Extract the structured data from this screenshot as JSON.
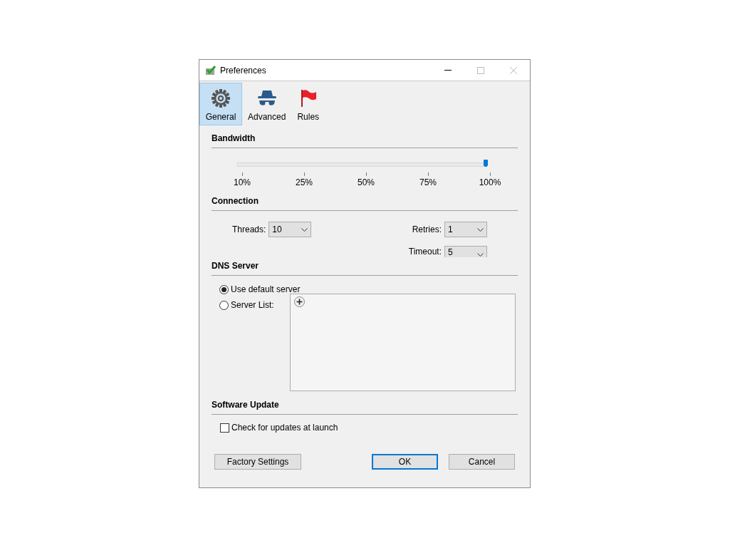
{
  "window": {
    "title": "Preferences"
  },
  "tabs": [
    {
      "label": "General",
      "selected": true,
      "kind": "gear"
    },
    {
      "label": "Advanced",
      "selected": false,
      "kind": "spy"
    },
    {
      "label": "Rules",
      "selected": false,
      "kind": "flag"
    }
  ],
  "bandwidth": {
    "heading": "Bandwidth",
    "level": 1,
    "ticks": [
      "10%",
      "25%",
      "50%",
      "75%",
      "100%"
    ]
  },
  "connection": {
    "heading": "Connection",
    "fields": [
      {
        "label": "Threads:",
        "value": "10"
      },
      {
        "label": "Retries:",
        "value": "1"
      },
      {
        "label": "Timeout:",
        "value": "5"
      }
    ]
  },
  "dns": {
    "heading": "DNS Server",
    "options": [
      {
        "label": "Use default server",
        "selected": true
      },
      {
        "label": "Server List:",
        "selected": false
      }
    ]
  },
  "update": {
    "heading": "Software Update",
    "checkbox": {
      "label": "Check for updates at launch",
      "checked": false
    }
  },
  "buttons": [
    {
      "label": "Factory Settings",
      "default": false
    },
    {
      "label": "OK",
      "default": true
    },
    {
      "label": "Cancel",
      "default": false
    }
  ]
}
